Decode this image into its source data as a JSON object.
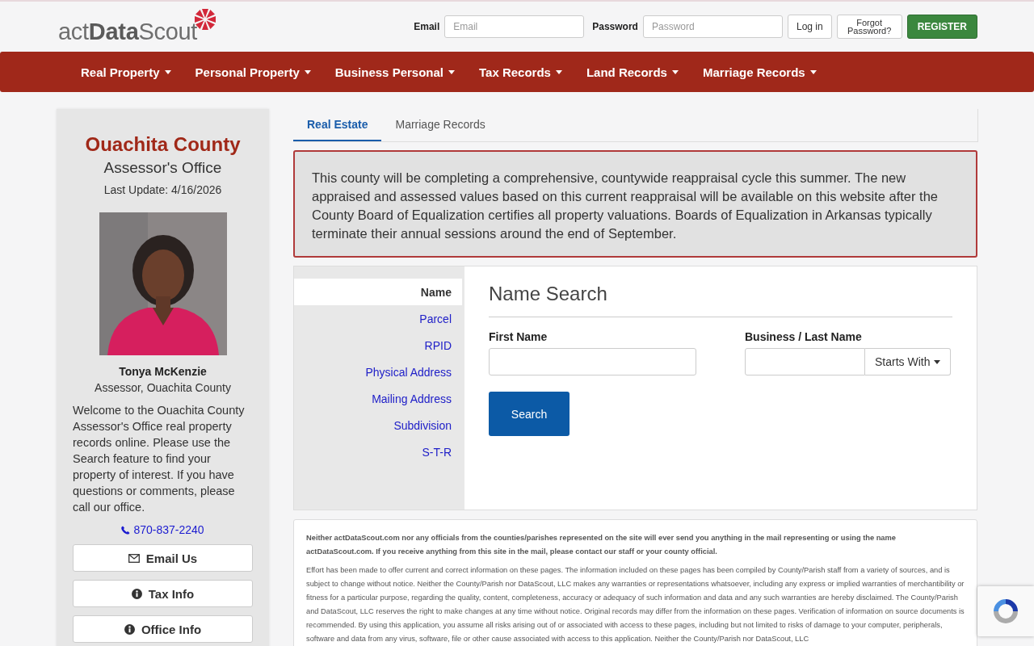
{
  "header": {
    "logo": "act**Data**Scout",
    "email_label": "Email",
    "email_placeholder": "Email",
    "password_label": "Password",
    "password_placeholder": "Password",
    "login_button": "Log in",
    "forgot_button": "Forgot Password?",
    "register_button": "REGISTER"
  },
  "nav": [
    "Real Property",
    "Personal Property",
    "Business Personal",
    "Tax Records",
    "Land Records",
    "Marriage Records"
  ],
  "sidebar": {
    "county": "Ouachita County",
    "office": "Assessor's Office",
    "last_update": "Last Update: 4/16/2026",
    "person_name": "Tonya McKenzie",
    "person_title": "Assessor, Ouachita County",
    "welcome": "Welcome to the Ouachita County Assessor's Office real property records online. Please use the Search feature to find your property of interest. If you have questions or comments, please call our office.",
    "phone": "870-837-2240",
    "buttons": [
      {
        "label": "Email Us",
        "kind": "envelope"
      },
      {
        "label": "Tax Info",
        "kind": "info"
      },
      {
        "label": "Office Info",
        "kind": "info"
      }
    ]
  },
  "tabs": [
    {
      "label": "Real Estate",
      "selected": true
    },
    {
      "label": "Marriage Records",
      "selected": false
    }
  ],
  "notice": "This county will be completing a comprehensive, countywide reappraisal cycle this summer. The new appraised and assessed values based on this current reappraisal will be available on this website after the County Board of Equalization certifies all property valuations. Boards of Equalization in Arkansas typically terminate their annual sessions around the end of September.",
  "search_types": [
    {
      "label": "Name",
      "selected": true
    },
    {
      "label": "Parcel",
      "selected": false
    },
    {
      "label": "RPID",
      "selected": false
    },
    {
      "label": "Physical Address",
      "selected": false
    },
    {
      "label": "Mailing Address",
      "selected": false
    },
    {
      "label": "Subdivision",
      "selected": false
    },
    {
      "label": "S-T-R",
      "selected": false
    }
  ],
  "search_form": {
    "title": "Name Search",
    "first_name_label": "First Name",
    "last_name_label": "Business / Last Name",
    "match_dropdown": "Starts With",
    "search_button": "Search"
  },
  "disclaimer": {
    "warning": "Neither actDataScout.com nor any officials from the counties/parishes represented on the site will ever send you anything in the mail representing or using the name actDataScout.com. If you receive anything from this site in the mail, please contact our staff or your county official.",
    "body": "Effort has been made to offer current and correct information on these pages. The information included on these pages has been compiled by County/Parish staff from a variety of sources, and is subject to change without notice. Neither the County/Parish nor DataScout, LLC makes any warranties or representations whatsoever, including any express or implied warranties of merchantibility or fitness for a particular purpose, regarding the quality, content, completeness, accuracy or adequacy of such information and data and any such warranties are hereby disclaimed. The County/Parish and DataScout, LLC reserves the right to make changes at any time without notice. Original records may differ from the information on these pages. Verification of information on source documents is recommended. By using this application, you assume all risks arising out of or associated with access to these pages, including but not limited to risks of damage to your computer, peripherals, software and data from any virus, software, file or other cause associated with access to this application. Neither the County/Parish nor DataScout, LLC"
  }
}
